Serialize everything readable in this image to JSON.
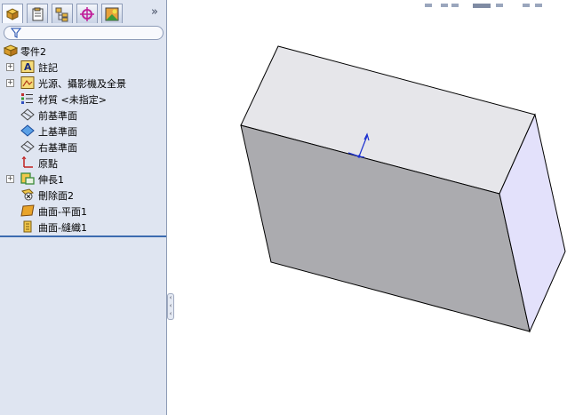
{
  "tree": {
    "root": "零件2",
    "items": [
      {
        "label": "註記",
        "icon": "annotation-icon",
        "expandable": true
      },
      {
        "label": "光源、攝影機及全景",
        "icon": "lights-camera-icon",
        "expandable": true
      },
      {
        "label": "材質 <未指定>",
        "icon": "material-icon",
        "expandable": false
      },
      {
        "label": "前基準面",
        "icon": "plane-icon",
        "expandable": false
      },
      {
        "label": "上基準面",
        "icon": "plane-selected-icon",
        "expandable": false
      },
      {
        "label": "右基準面",
        "icon": "plane-icon",
        "expandable": false
      },
      {
        "label": "原點",
        "icon": "origin-icon",
        "expandable": false
      },
      {
        "label": "伸長1",
        "icon": "extrude-icon",
        "expandable": true
      },
      {
        "label": "刪除面2",
        "icon": "delete-face-icon",
        "expandable": false
      },
      {
        "label": "曲面-平面1",
        "icon": "planar-surface-icon",
        "expandable": false
      },
      {
        "label": "曲面-縫織1",
        "icon": "knit-surface-icon",
        "expandable": false
      }
    ]
  },
  "tabs": [
    "feature-manager-tab-icon",
    "property-manager-tab-icon",
    "configuration-manager-tab-icon",
    "dimxpert-tab-icon",
    "display-manager-tab-icon"
  ],
  "more_glyph": "»",
  "colors": {
    "panel": "#dfe5f1",
    "box_top": "#e6e6ea",
    "box_front": "#ababaf",
    "box_side": "#e3e1fb",
    "edge": "#000000",
    "triad": "#1a2fd0"
  }
}
